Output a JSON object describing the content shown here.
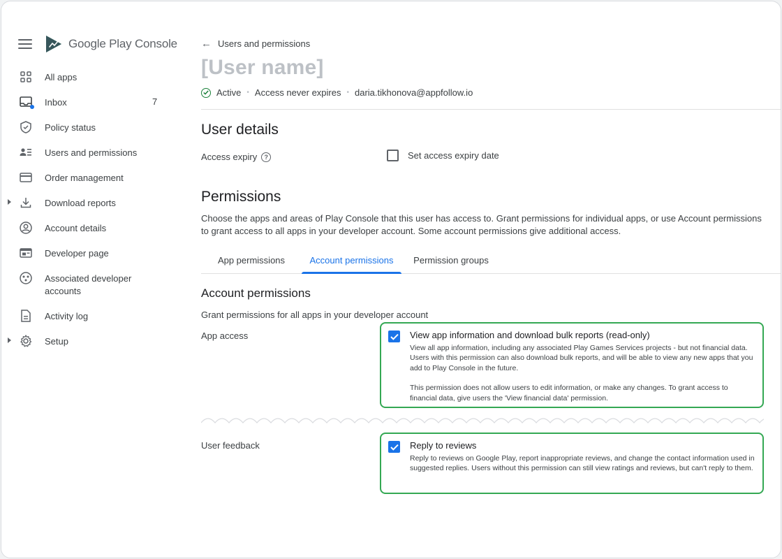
{
  "app": {
    "brand_google": "Google",
    "brand_play": "Play",
    "brand_console": "Console"
  },
  "sidebar": {
    "items": [
      {
        "label": "All apps",
        "icon": "grid-icon"
      },
      {
        "label": "Inbox",
        "icon": "inbox-icon",
        "count": "7"
      },
      {
        "label": "Policy status",
        "icon": "shield-icon"
      },
      {
        "label": "Users and permissions",
        "icon": "users-icon"
      },
      {
        "label": "Order management",
        "icon": "card-icon"
      },
      {
        "label": "Download reports",
        "icon": "download-icon"
      },
      {
        "label": "Account details",
        "icon": "account-icon"
      },
      {
        "label": "Developer page",
        "icon": "webpage-icon"
      },
      {
        "label": "Associated developer accounts",
        "icon": "associated-accounts-icon"
      },
      {
        "label": "Activity log",
        "icon": "document-icon"
      },
      {
        "label": "Setup",
        "icon": "gear-icon"
      }
    ]
  },
  "header": {
    "back_label": "Users and permissions",
    "user_name": "[User name]",
    "status": "Active",
    "access": "Access never expires",
    "email": "daria.tikhonova@appfollow.io"
  },
  "user_details": {
    "title": "User details",
    "access_expiry_label": "Access expiry",
    "set_expiry_label": "Set access expiry date",
    "set_expiry_checked": false
  },
  "permissions": {
    "title": "Permissions",
    "description": "Choose the apps and areas of Play Console that this user has access to. Grant permissions for individual apps, or use Account permissions to grant access to all apps in your developer account. Some account permissions give additional access.",
    "tabs": [
      "App permissions",
      "Account permissions",
      "Permission groups"
    ],
    "active_tab": "Account permissions"
  },
  "account_permissions": {
    "title": "Account permissions",
    "description": "Grant permissions for all apps in your developer account",
    "app_access": {
      "label": "App access",
      "option_title": "View app information and download bulk reports (read-only)",
      "option_body_1": "View all app information, including any associated Play Games Services projects - but not financial data. Users with this permission can also download bulk reports, and will be able to view any new apps that you add to Play Console in the future.",
      "option_body_2": "This permission does not allow users to edit information, or make any changes. To grant access to financial data, give users the 'View financial data' permission.",
      "checked": true
    },
    "user_feedback": {
      "label": "User feedback",
      "option_title": "Reply to reviews",
      "option_body": "Reply to reviews on Google Play, report inappropriate reviews, and change the contact information used in suggested replies. Users without this permission can still view ratings and reviews, but can't reply to them.",
      "checked": true
    }
  },
  "colors": {
    "accent": "#1a73e8",
    "highlight_border": "#34a853",
    "active_status": "#188038",
    "placeholder_name": "#bdc1c6"
  }
}
